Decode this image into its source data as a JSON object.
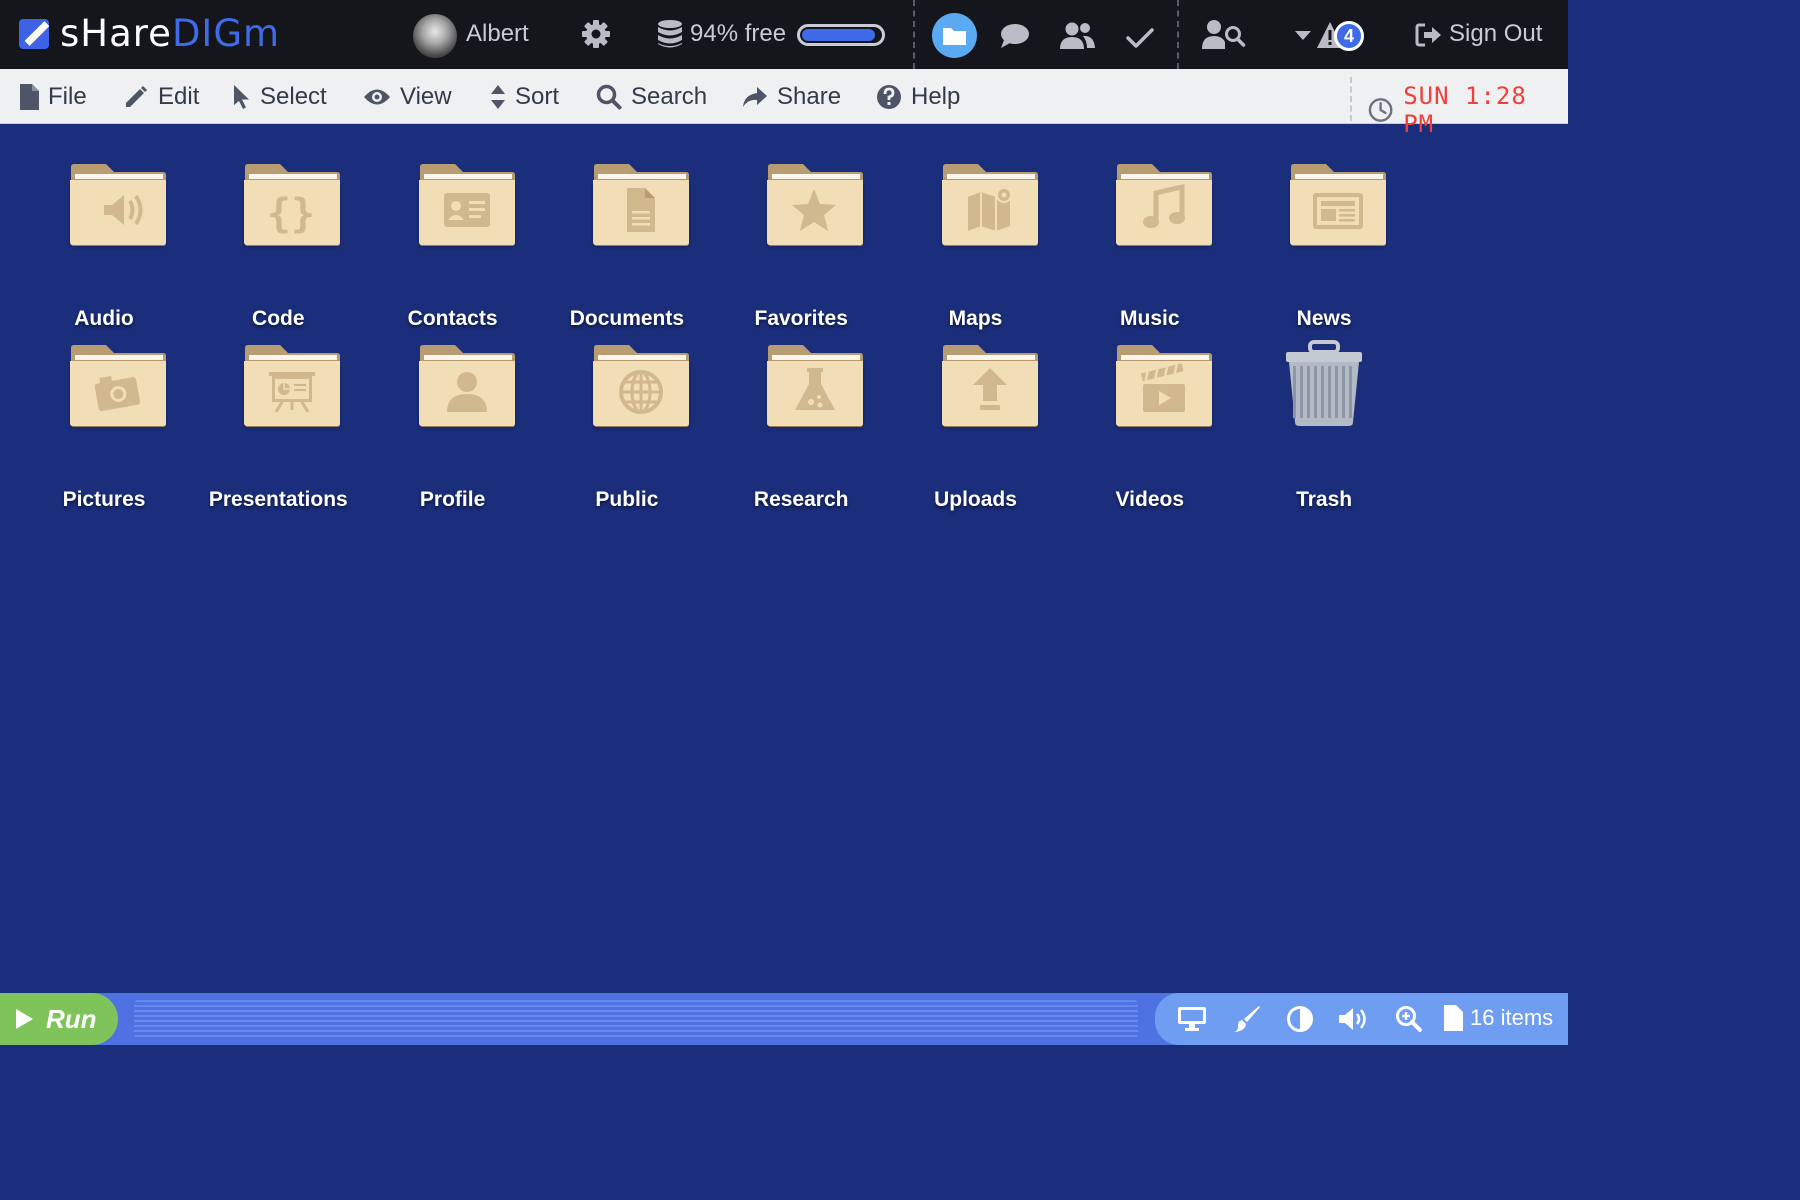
{
  "app": {
    "logo_part1": "sHare",
    "logo_part2": "DIGm"
  },
  "topbar": {
    "user_name": "Albert",
    "storage_text": "94% free",
    "storage_free_fraction": 0.94,
    "alert_count": "4",
    "sign_out_label": "Sign Out"
  },
  "menu": {
    "file": "File",
    "edit": "Edit",
    "select": "Select",
    "view": "View",
    "sort": "Sort",
    "search": "Search",
    "share": "Share",
    "help": "Help",
    "clock": "SUN 1:28 PM"
  },
  "folders": [
    {
      "label": "Audio",
      "icon": "speaker-icon"
    },
    {
      "label": "Code",
      "icon": "braces-icon"
    },
    {
      "label": "Contacts",
      "icon": "contact-card-icon"
    },
    {
      "label": "Documents",
      "icon": "document-icon"
    },
    {
      "label": "Favorites",
      "icon": "star-icon"
    },
    {
      "label": "Maps",
      "icon": "map-icon"
    },
    {
      "label": "Music",
      "icon": "music-note-icon"
    },
    {
      "label": "News",
      "icon": "newspaper-icon"
    },
    {
      "label": "Pictures",
      "icon": "camera-icon"
    },
    {
      "label": "Presentations",
      "icon": "presentation-icon"
    },
    {
      "label": "Profile",
      "icon": "person-icon"
    },
    {
      "label": "Public",
      "icon": "globe-icon"
    },
    {
      "label": "Research",
      "icon": "flask-icon"
    },
    {
      "label": "Uploads",
      "icon": "upload-arrow-icon"
    },
    {
      "label": "Videos",
      "icon": "clapperboard-icon"
    },
    {
      "label": "Trash",
      "icon": "trash-can-icon"
    }
  ],
  "bottombar": {
    "run_label": "Run",
    "items_count": "16 items"
  },
  "colors": {
    "desktop": "#1b2e7c",
    "accent": "#3f6ae8",
    "folder": "#f2deb6",
    "clock": "#f1403b",
    "run": "#7ec45a"
  }
}
